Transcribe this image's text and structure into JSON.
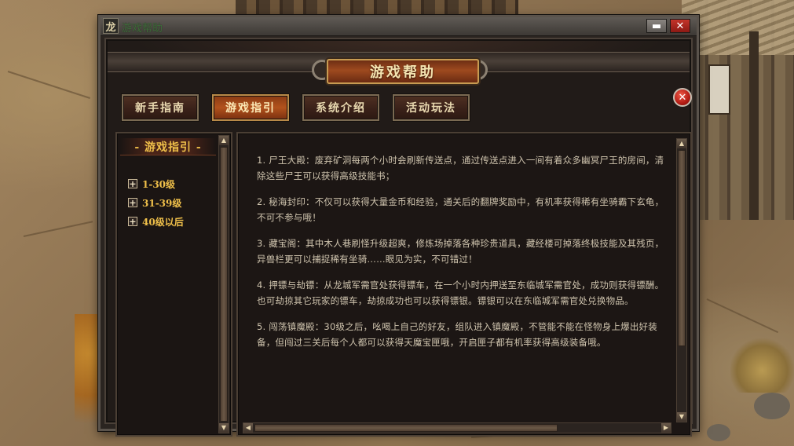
{
  "window": {
    "app_icon_glyph": "龙",
    "title": "游戏帮助",
    "minimize_glyph": "▬",
    "close_glyph": "✕"
  },
  "banner": {
    "title": "游戏帮助"
  },
  "tabs": [
    {
      "label": "新手指南",
      "active": false
    },
    {
      "label": "游戏指引",
      "active": true
    },
    {
      "label": "系统介绍",
      "active": false
    },
    {
      "label": "活动玩法",
      "active": false
    }
  ],
  "close_button_glyph": "✕",
  "left_panel": {
    "heading": "- 游戏指引 -",
    "expand_glyph": "+",
    "items": [
      {
        "label": "1-30级"
      },
      {
        "label": "31-39级"
      },
      {
        "label": "40级以后"
      }
    ]
  },
  "content": {
    "paragraphs": [
      "1. 尸王大殿：废弃矿洞每两个小时会刷新传送点，通过传送点进入一间有着众多幽冥尸王的房间，清除这些尸王可以获得高级技能书；",
      "2. 秘海封印：不仅可以获得大量金币和经验，通关后的翻牌奖励中，有机率获得稀有坐骑霸下玄龟，不可不参与哦！",
      "3. 藏宝阁：其中木人巷刷怪升级超爽，修炼场掉落各种珍贵道具，藏经楼可掉落终极技能及其残页，异兽栏更可以捕捉稀有坐骑……眼见为实，不可错过！",
      "4. 押镖与劫镖：从龙城军需官处获得镖车，在一个小时内押送至东临城军需官处，成功则获得镖酬。也可劫掠其它玩家的镖车，劫掠成功也可以获得镖银。镖银可以在东临城军需官处兑换物品。",
      "5. 闯荡镇魔殿：30级之后，吆喝上自己的好友，组队进入镇魔殿，不管能不能在怪物身上爆出好装备，但闯过三关后每个人都可以获得天魔宝匣哦，开启匣子都有机率获得高级装备哦。"
    ]
  },
  "scrollbars": {
    "up_glyph": "▲",
    "down_glyph": "▼",
    "left_glyph": "◀",
    "right_glyph": "▶"
  },
  "colors": {
    "accent_gold": "#f0c04a",
    "active_tab": "#b2521c",
    "body_text": "#cfc4ae",
    "close_red": "#b31c14"
  }
}
